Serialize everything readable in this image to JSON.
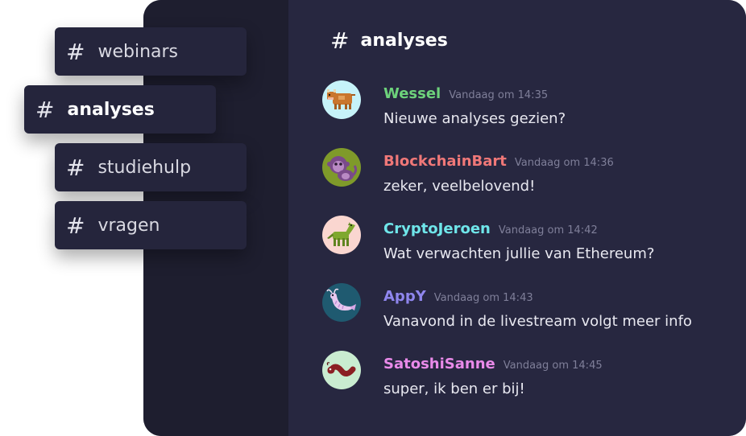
{
  "channel_header": {
    "hash": "#",
    "name": "analyses"
  },
  "channels": [
    {
      "label": "webinars"
    },
    {
      "label": "analyses"
    },
    {
      "label": "studiehulp"
    },
    {
      "label": "vragen"
    }
  ],
  "messages": [
    {
      "author": "Wessel",
      "time": "Vandaag om 14:35",
      "text": "Nieuwe analyses gezien?",
      "color": "#6dd27b",
      "avatar_bg": "#c6f3f9",
      "avatar_icon": "cow-icon"
    },
    {
      "author": "BlockchainBart",
      "time": "Vandaag om 14:36",
      "text": "zeker, veelbelovend!",
      "color": "#f07878",
      "avatar_bg": "#7f9a2a",
      "avatar_icon": "monkey-icon"
    },
    {
      "author": "CryptoJeroen",
      "time": "Vandaag om 14:42",
      "text": "Wat verwachten jullie van Ethereum?",
      "color": "#6fe6ea",
      "avatar_bg": "#fad6d0",
      "avatar_icon": "horse-icon"
    },
    {
      "author": "AppY",
      "time": "Vandaag om 14:43",
      "text": "Vanavond in de livestream volgt meer info",
      "color": "#8f86ee",
      "avatar_bg": "#1f5a70",
      "avatar_icon": "shrimp-icon"
    },
    {
      "author": "SatoshiSanne",
      "time": "Vandaag om 14:45",
      "text": "super, ik ben er bij!",
      "color": "#e98ae9",
      "avatar_bg": "#c9ecd0",
      "avatar_icon": "worm-icon"
    }
  ]
}
